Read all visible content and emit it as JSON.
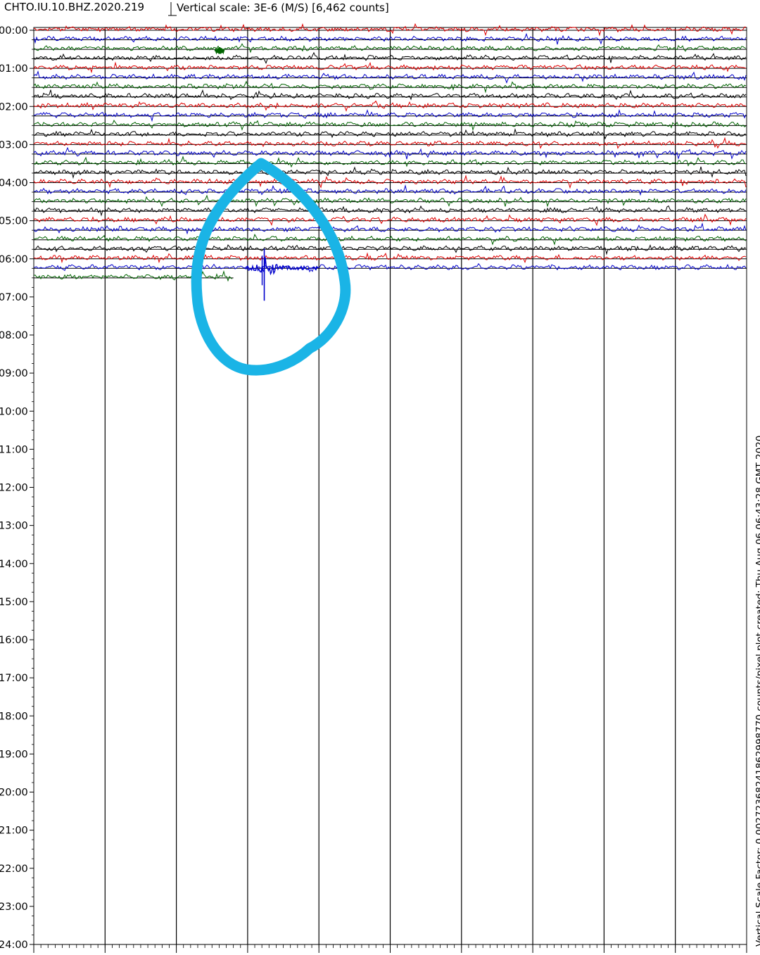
{
  "header": {
    "station": "CHTO.IU.10.BHZ.2020.219",
    "scale_label": "Vertical scale: 3E-6 (M/S) [6,462 counts]"
  },
  "side_note": "Vertical Scale Factor: 0.00272368241862998770 counts/pixel plot created: Thu Aug 06 06:43:28 GMT 2020",
  "colors": {
    "trace_cycle": [
      "#e00000",
      "#0000cc",
      "#006400",
      "#000000"
    ],
    "annotation": "#1ab4e6",
    "grid": "#000000"
  },
  "chart_data": {
    "type": "line",
    "title": "",
    "xlabel": "",
    "ylabel": "",
    "time_labels": [
      "00:00",
      "01:00",
      "02:00",
      "03:00",
      "04:00",
      "05:00",
      "06:00",
      "07:00",
      "08:00",
      "09:00",
      "10:00",
      "11:00",
      "12:00",
      "13:00",
      "14:00",
      "15:00",
      "16:00",
      "17:00",
      "18:00",
      "19:00",
      "20:00",
      "21:00",
      "22:00",
      "23:00",
      "24:00"
    ],
    "ylim": [
      0,
      24
    ],
    "minute_range": [
      0,
      15
    ],
    "minute_major_ticks": [
      0,
      1.5,
      3,
      4.5,
      6,
      7.5,
      9,
      10.5,
      12,
      13.5,
      15
    ],
    "traces_per_hour": 4,
    "trace_colors_cycle": [
      "red",
      "blue",
      "green",
      "black"
    ],
    "traces_recorded": 27,
    "last_trace_end_minute": 4.2,
    "event": {
      "hour": 6.25,
      "minute_start": 4.45,
      "minute_peak": 4.85,
      "minute_end": 6.0,
      "color": "blue"
    },
    "small_burst": {
      "hour": 0.5,
      "minute": 3.9,
      "color": "green"
    },
    "annotation": {
      "type": "hand-drawn circle",
      "color": "#1ab4e6",
      "around": "event"
    }
  }
}
